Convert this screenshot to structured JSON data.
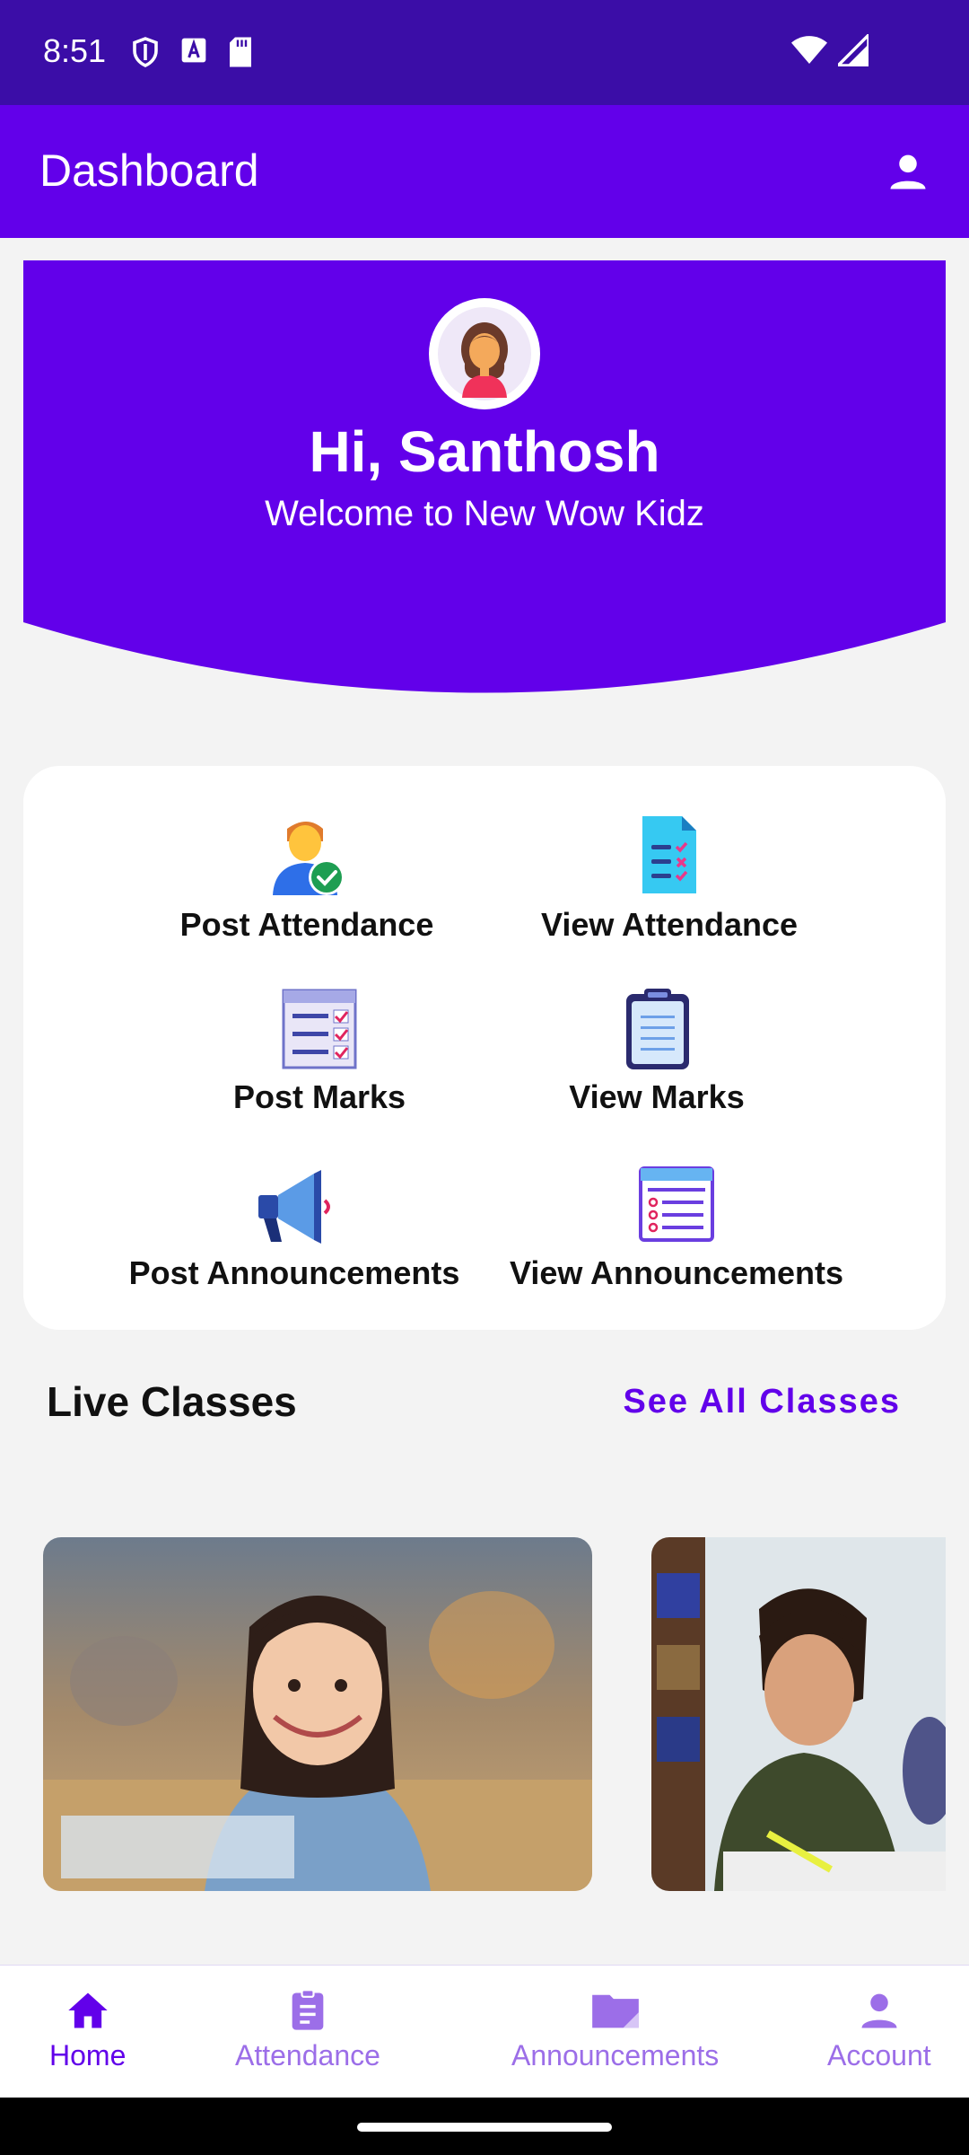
{
  "status_bar": {
    "time": "8:51"
  },
  "app_bar": {
    "title": "Dashboard",
    "account_icon": "person-icon"
  },
  "hero": {
    "greeting": "Hi, Santhosh",
    "welcome": "Welcome to New Wow Kidz",
    "background_color": "#6200ea"
  },
  "actions": [
    {
      "label": "Post Attendance",
      "icon": "user-check-icon"
    },
    {
      "label": "View Attendance",
      "icon": "document-check-icon"
    },
    {
      "label": "Post Marks",
      "icon": "checklist-icon"
    },
    {
      "label": "View Marks",
      "icon": "clipboard-icon"
    },
    {
      "label": "Post Announcements",
      "icon": "megaphone-icon"
    },
    {
      "label": "View Announcements",
      "icon": "browser-list-icon"
    }
  ],
  "live_classes": {
    "title": "Live Classes",
    "see_all": "See All Classes"
  },
  "bottom_nav": {
    "items": [
      {
        "label": "Home",
        "icon": "home-icon",
        "active": true
      },
      {
        "label": "Attendance",
        "icon": "assignment-icon",
        "active": false
      },
      {
        "label": "Announcements",
        "icon": "folder-icon",
        "active": false
      },
      {
        "label": "Account",
        "icon": "person-icon",
        "active": false
      }
    ]
  },
  "colors": {
    "primary": "#6200ea",
    "status_bar": "#3b0da7",
    "nav_inactive": "#9c6ee8"
  }
}
